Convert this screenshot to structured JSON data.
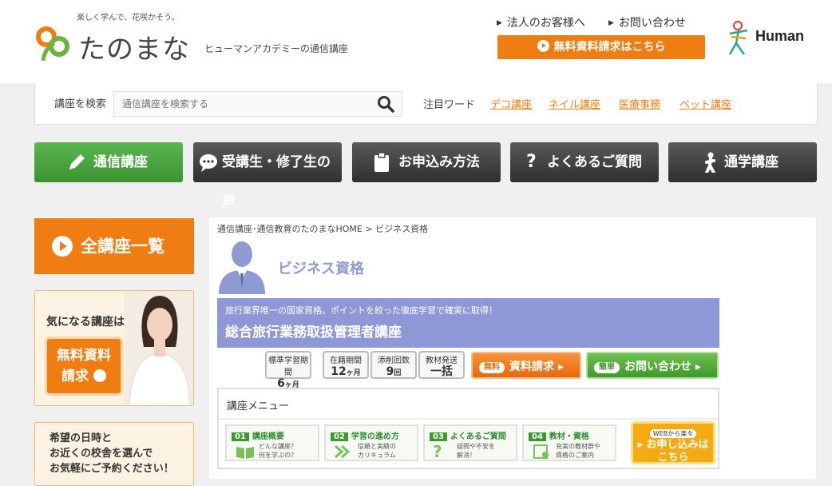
{
  "header": {
    "tagline": "楽しく学んで、花咲かそう。",
    "logo_text": "たのまな",
    "subtitle": "ヒューマンアカデミーの通信講座",
    "links": [
      "法人のお客様へ",
      "お問い合わせ"
    ],
    "cta": "無料資料請求はこちら",
    "brand": "Human"
  },
  "search": {
    "label": "講座を検索",
    "placeholder": "通信講座を検索する",
    "keywords_label": "注目ワード",
    "keywords": [
      "デコ講座",
      "ネイル講座",
      "医療事務",
      "ペット講座"
    ]
  },
  "nav": [
    "通信講座",
    "受講生・修了生の声",
    "お申込み方法",
    "よくあるご質問",
    "通学講座"
  ],
  "sidebar": {
    "all_courses": "全講座一覧",
    "banner1_title": "気になる講座は",
    "banner1_button": [
      "無料資料",
      "請求"
    ],
    "banner2_lines": [
      "希望の日時と",
      "お近くの校舎を選んで",
      "お気軽にご予約ください！"
    ]
  },
  "main": {
    "breadcrumb": "通信講座･通信教育のたのまなHOME > ビジネス資格",
    "category": "ビジネス資格",
    "course_sub": "旅行業界唯一の国家資格。ポイントを絞った徹底学習で確実に取得！",
    "course_title": "総合旅行業務取扱管理者講座",
    "stats": [
      {
        "label": "標準学習期間",
        "value": "6",
        "unit": "ヶ月"
      },
      {
        "label": "在籍期間",
        "value": "12",
        "unit": "ヶ月"
      },
      {
        "label": "添削回数",
        "value": "9",
        "unit": "回"
      },
      {
        "label": "教材発送",
        "value": "一括",
        "unit": ""
      }
    ],
    "btn_request": {
      "pill": "無料",
      "label": "資料請求 ▸"
    },
    "btn_contact": {
      "pill": "簡単",
      "label": "お問い合わせ ▸"
    },
    "menu_title": "講座メニュー",
    "menu_items": [
      {
        "num": "01",
        "title": "講座概要",
        "desc": [
          "どんな講座？",
          "何を学ぶの？"
        ]
      },
      {
        "num": "02",
        "title": "学習の進め方",
        "desc": [
          "信頼と実績の",
          "カリキュラム"
        ]
      },
      {
        "num": "03",
        "title": "よくあるご質問",
        "desc": [
          "疑問や不安を",
          "解消！"
        ]
      },
      {
        "num": "04",
        "title": "教材・資格",
        "desc": [
          "充実の教材群や",
          "資格のご案内"
        ]
      }
    ],
    "apply": {
      "small": "WEBから楽々",
      "lines": [
        "▸ お申し込みは",
        "こちら"
      ]
    }
  },
  "colors": {
    "accent": "#f07d12",
    "green": "#4aa33e",
    "category": "#8e9bd3"
  }
}
